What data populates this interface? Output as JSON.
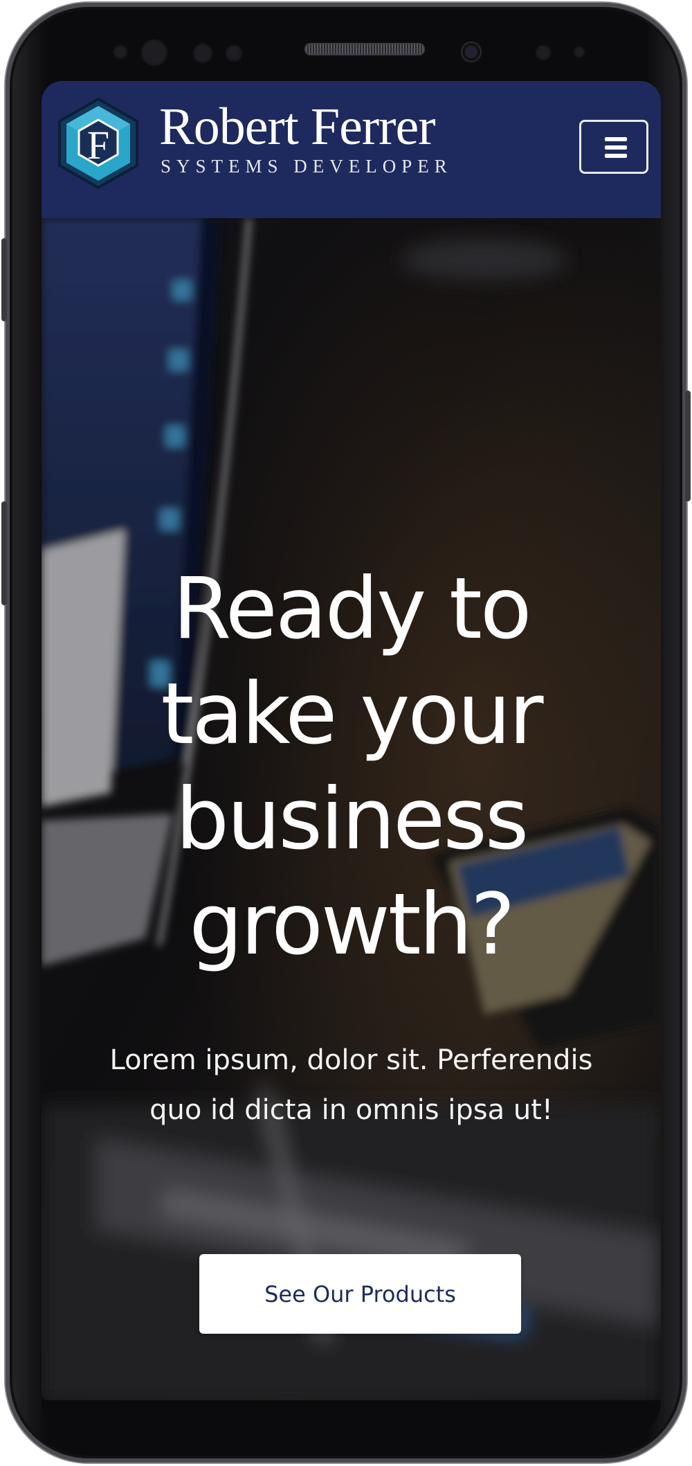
{
  "brand": {
    "logo_letter": "F",
    "name": "Robert Ferrer",
    "tagline": "SYSTEMS DEVELOPER"
  },
  "nav": {
    "menu_icon": "hamburger-menu-icon"
  },
  "hero": {
    "headline_lines": [
      "Ready to",
      "take your",
      "business",
      "growth?"
    ],
    "subtext_lines": [
      "Lorem ipsum, dolor sit. Perferendis",
      "quo id dicta in omnis ipsa ut!"
    ],
    "cta_label": "See Our Products"
  },
  "colors": {
    "navbar": "#1e2a5e",
    "logo_teal": "#2aa6c9",
    "cta_background": "#ffffff",
    "cta_text": "#1e2a5e",
    "hero_text": "#ffffff"
  }
}
